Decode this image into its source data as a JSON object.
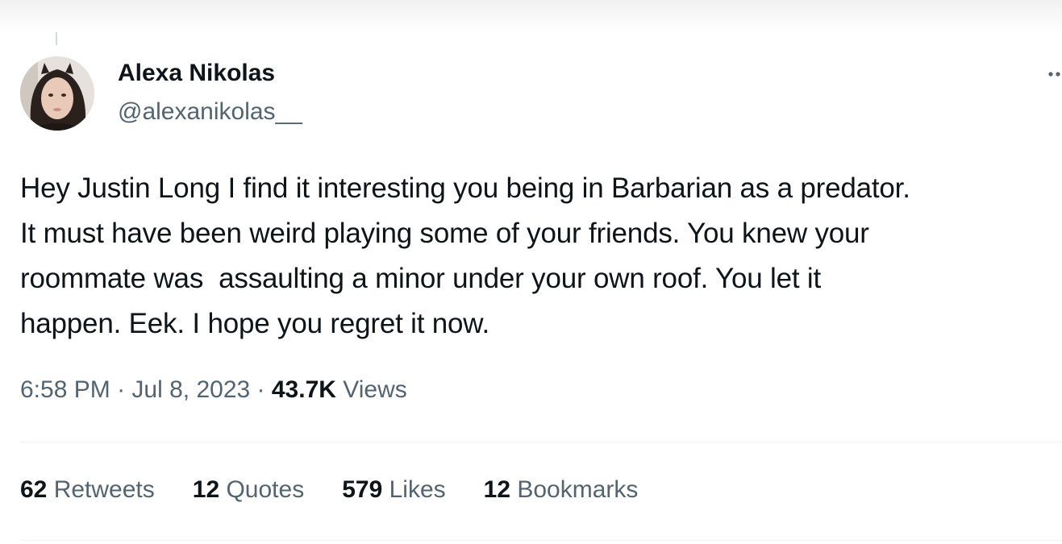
{
  "tweet": {
    "author": {
      "display_name": "Alexa Nikolas",
      "handle": "@alexanikolas__"
    },
    "text": "Hey Justin Long I find it interesting you being in Barbarian as a predator.\nIt must have been weird playing some of your friends. You knew your\nroommate was  assaulting a minor under your own roof. You let it\nhappen. Eek. I hope you regret it now.",
    "time": "6:58 PM",
    "separator": " · ",
    "date": "Jul 8, 2023",
    "views_count": "43.7K",
    "views_label": " Views",
    "stats": {
      "retweets_count": "62",
      "retweets_label": " Retweets",
      "quotes_count": "12",
      "quotes_label": " Quotes",
      "likes_count": "579",
      "likes_label": " Likes",
      "bookmarks_count": "12",
      "bookmarks_label": " Bookmarks"
    }
  },
  "icons": {
    "avatar": "profile-photo",
    "more": "more-dots-icon"
  },
  "colors": {
    "text_primary": "#0f1419",
    "text_secondary": "#536471",
    "divider": "#eff3f4"
  }
}
